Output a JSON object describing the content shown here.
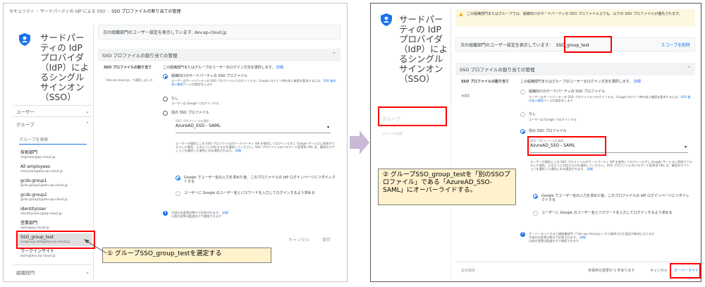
{
  "left": {
    "breadcrumb": [
      "セキュリティ",
      "サードパーティの IdP による SSO",
      "SSO プロファイルの割り当ての管理"
    ],
    "nav_title": "サードパーティの IdP プロバイダ（IdP）によるシングルサインオン（SSO）",
    "nav_users": "ユーザー",
    "nav_groups": "グループ",
    "group_search_placeholder": "グループを検索",
    "groups": [
      {
        "name": "技術部門",
        "email": "engineer@ep-cloud.jp"
      },
      {
        "name": "All employees",
        "email": "everyone@dev.ep-cloud.jp"
      },
      {
        "name": "gcds-group1",
        "email": "gcds-group1@dev.ep-cloud.jp"
      },
      {
        "name": "gcds-group2",
        "email": "gcds-group2@dev.ep-cloud.jp"
      },
      {
        "name": "IdentityUser",
        "email": "identityusers@ep-cloud.jp"
      },
      {
        "name": "営業部門",
        "email": "sales@ep-cloud.jp"
      },
      {
        "name": "SSO_group_test",
        "email": "ssogroup_test@dev.ep-cloud.jp"
      },
      {
        "name": "ワークインサイト",
        "email": "work@dev.ep-cloud.jp"
      }
    ],
    "nav_org": "組織部門",
    "org_row": "次の組織部門のユーザー設定を表示しています: dev.ep-cloud.jp",
    "section_title": "SSO プロファイルの割り当ての管理",
    "assign_label": "SSO プロファイルの割り当て",
    "assign_sub": "「dev.ep-cloud.jp」で適用しました",
    "intro": "この組織部門またはグループのユーザーのログイン方法を選択します。",
    "intro_link": "詳細",
    "option1_title": "組織向けのサードパーティの SSO プロファイル",
    "option1_desc": "ユーザーはサードパーティの SSO プロファイルでログインする。Google ログイン時の本人確認を要求するには、",
    "option1_link": "SSO 後の本人確認",
    "option1_desc2": "ページの設定をします",
    "option2_title": "なし",
    "option2_desc": "ユーザーは Google でログインする",
    "option3_title": "別の SSO プロファイル",
    "select_label": "SSO プロファイルを選択",
    "select_value": "AzureAD_SSO - SAML",
    "note": "ユーザーが個別にこの SSO プロファイルのサードパーティ IdP を使用してログインせずに Google サービスに直接アクセスした場合、どのように対応するかを選択してください。SSO プロファイルのパスワード変更用 URL は、最初のオプションを選択した場合にのみ適用されます。",
    "note_link": "詳細",
    "sub1": "Google でユーザー名の入力を求めた後、このプロファイルの IdP ログインページにリダイレクトする",
    "sub2": "ユーザーに Google のユーザー名とパスワードを入力してログインするよう求める",
    "info": "大部分の変更は数分で反映されます。",
    "info_link": "詳細",
    "info2": "以前の変更は監査ログで確認できます",
    "cancel": "キャンセル",
    "save": "保存",
    "callout": "① グループSSO_group_testを選定する"
  },
  "right": {
    "warning": "この組織部門またはグループでは、組織向けのサードパーティの SSO プロファイルよりも、以下の SSO プロファイルが優先されます。",
    "org_prefix": "次の組織部門のユーザー設定を表示しています:",
    "org_value": "SSO_group_test",
    "remove_scope": "スコープを削除",
    "section_title": "SSO プロファイルの割り当ての管理",
    "assign_label": "SSO プロファイルの割り当て",
    "assign_sub": "未設定",
    "nav_title": "サードパーティの IdP プロバイダ（IdP）によるシングルサインオン（SSO）",
    "nav_groups": "グループ",
    "group_search": "グループを検索",
    "select_value": "AzureAD_SSO - SAML",
    "select_label": "SSO プロファイルを選択",
    "info": "オーバーライドすると親組織部門（「dev.ep-cloud.jp」）から継承された設定が無効になります",
    "info2": "大部分の変更は数分で反映されます。",
    "info_link": "詳細",
    "info3": "以前の変更は監査ログで確認できます",
    "footer_left": "設定解除",
    "footer_unsaved": "未保存の変更が 1 件あります",
    "cancel": "キャンセル",
    "override": "オーバーライド",
    "callout": "② グループSSO_group_testを「別のSSOプロファイル」である「AzureAD_SSO-SAML」にオーバーライドする。"
  }
}
